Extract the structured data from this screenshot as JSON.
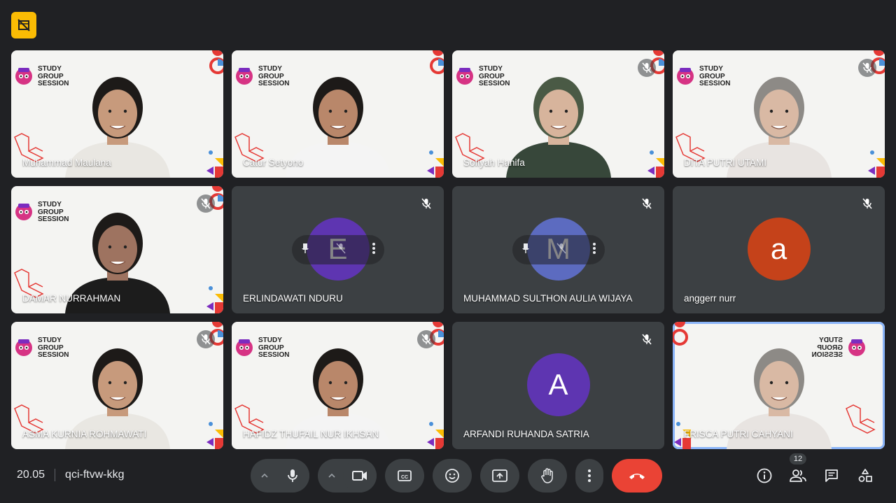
{
  "meeting": {
    "time": "20.05",
    "code": "qci-ftvw-kkg",
    "people_count": "12"
  },
  "colors": {
    "background": "#202124",
    "tile_bg": "#3c4043",
    "end_call": "#ea4335",
    "warning_badge": "#fbbc04",
    "active_outline": "#8ab4f8"
  },
  "branding": {
    "logo_text": "STUDY GROUP SESSION"
  },
  "participants": [
    {
      "name": "Muhammad Maulana",
      "video": true,
      "muted": false
    },
    {
      "name": "Catur Setyono",
      "video": true,
      "muted": false
    },
    {
      "name": "Sofiyah Hanifa",
      "video": true,
      "muted": true
    },
    {
      "name": "DITA PUTRI UTAMI",
      "video": true,
      "muted": true
    },
    {
      "name": "DAMAR NURRAHMAN",
      "video": true,
      "muted": true
    },
    {
      "name": "ERLINDAWATI NDURU",
      "video": false,
      "muted": true,
      "initial": "E",
      "avatar_color": "#5e35b1",
      "hover_controls": true
    },
    {
      "name": "MUHAMMAD SULTHON AULIA WIJAYA",
      "video": false,
      "muted": true,
      "initial": "M",
      "avatar_color": "#5c6bc0",
      "hover_controls": true
    },
    {
      "name": "anggerr nurr",
      "video": false,
      "muted": true,
      "initial": "a",
      "avatar_color": "#c5421a"
    },
    {
      "name": "ASMA KURNIA ROHMAWATI",
      "video": true,
      "muted": true
    },
    {
      "name": "HAFIDZ THUFAIL NUR IKHSAN",
      "video": true,
      "muted": true
    },
    {
      "name": "ARFANDI RUHANDA SATRIA",
      "video": false,
      "muted": true,
      "initial": "A",
      "avatar_color": "#5e35b1"
    },
    {
      "name": "FRISCA PUTRI CAHYANI",
      "video": true,
      "muted": false,
      "active": true
    }
  ],
  "controls": {
    "icons": [
      "chevron-up-icon",
      "microphone-icon",
      "chevron-up-icon",
      "camera-icon",
      "captions-icon",
      "emoji-icon",
      "present-icon",
      "raise-hand-icon",
      "more-options-icon",
      "end-call-icon"
    ],
    "right_icons": [
      "info-icon",
      "people-icon",
      "chat-icon",
      "activities-icon"
    ]
  }
}
